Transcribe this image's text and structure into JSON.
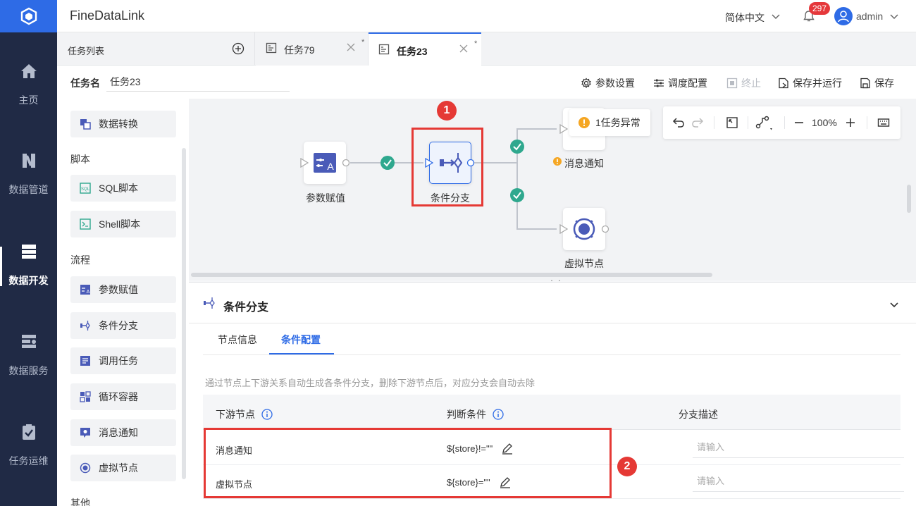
{
  "app": {
    "title": "FineDataLink",
    "language": "简体中文",
    "notification_count": "297",
    "username": "admin"
  },
  "colors": {
    "primary": "#2e6be6",
    "nav_bg": "#202a45",
    "highlight": "#e53935",
    "success": "#2fa88e",
    "warning": "#f5a623"
  },
  "nav": [
    {
      "label": "主页",
      "icon": "home-icon"
    },
    {
      "label": "数据管道",
      "icon": "pipeline-icon"
    },
    {
      "label": "数据开发",
      "icon": "dev-icon",
      "active": true
    },
    {
      "label": "数据服务",
      "icon": "service-icon"
    },
    {
      "label": "任务运维",
      "icon": "ops-icon"
    }
  ],
  "tabs": {
    "list_label": "任务列表",
    "items": [
      {
        "label": "任务79",
        "modified": "*",
        "active": false
      },
      {
        "label": "任务23",
        "modified": "*",
        "active": true
      }
    ]
  },
  "toolbar": {
    "taskname_label": "任务名",
    "taskname_value": "任务23",
    "buttons": [
      "参数设置",
      "调度配置",
      "终止",
      "保存并运行",
      "保存"
    ]
  },
  "palette": {
    "top_item": "数据转换",
    "groups": [
      {
        "label": "脚本",
        "items": [
          "SQL脚本",
          "Shell脚本"
        ]
      },
      {
        "label": "流程",
        "items": [
          "参数赋值",
          "条件分支",
          "调用任务",
          "循环容器",
          "消息通知",
          "虚拟节点"
        ]
      },
      {
        "label": "其他",
        "items": []
      }
    ]
  },
  "canvas": {
    "nodes": {
      "param": "参数赋值",
      "branch": "条件分支",
      "message": "消息通知",
      "virtual": "虚拟节点"
    },
    "alert": "1任务异常",
    "zoom": "100%",
    "markers": [
      "1",
      "2"
    ]
  },
  "panel": {
    "title": "条件分支",
    "tabs": [
      "节点信息",
      "条件配置"
    ],
    "active_tab": 1,
    "hint": "通过节点上下游关系自动生成各条件分支，删除下游节点后，对应分支会自动去除",
    "columns": [
      "下游节点",
      "判断条件",
      "分支描述"
    ],
    "rows": [
      {
        "node": "消息通知",
        "condition": "${store}!=\"\"",
        "description_placeholder": "请输入"
      },
      {
        "node": "虚拟节点",
        "condition": "${store}=\"\"",
        "description_placeholder": "请输入"
      }
    ]
  }
}
